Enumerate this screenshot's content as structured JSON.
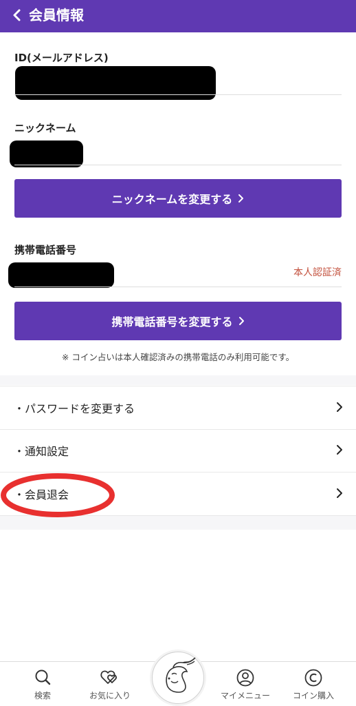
{
  "header": {
    "title": "会員情報",
    "back_icon": "chevron-left-icon"
  },
  "profile": {
    "id_label": "ID(メールアドレス)",
    "nickname_label": "ニックネーム",
    "change_nickname_button": "ニックネームを変更する",
    "phone_label": "携帯電話番号",
    "phone_status": "本人認証済",
    "change_phone_button": "携帯電話番号を変更する",
    "note": "※ コイン占いは本人確認済みの携帯電話のみ利用可能です。"
  },
  "menu": {
    "items": [
      {
        "label": "・パスワードを変更する"
      },
      {
        "label": "・通知設定"
      },
      {
        "label": "・会員退会"
      }
    ]
  },
  "annotation": {
    "highlight_color": "#e8302f"
  },
  "nav": {
    "items": [
      {
        "label": "検索",
        "icon": "search-icon"
      },
      {
        "label": "お気に入り",
        "icon": "heart-icon"
      },
      {
        "label": "",
        "icon": "fortune-teller-logo-icon"
      },
      {
        "label": "マイメニュー",
        "icon": "user-icon"
      },
      {
        "label": "コイン購入",
        "icon": "coin-icon"
      }
    ]
  },
  "colors": {
    "brand": "#5f39b2",
    "verified": "#c24e3a"
  }
}
